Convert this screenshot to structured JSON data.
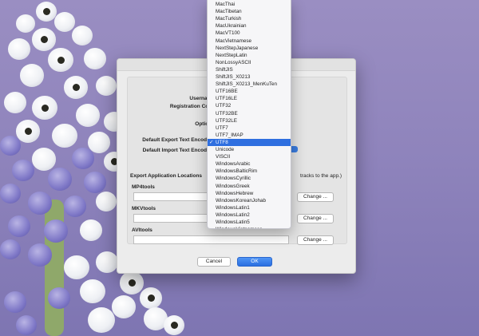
{
  "dialog": {
    "labels": {
      "username": "Username:",
      "registration_code": "Registration Code:",
      "options": "Options:",
      "default_export": "Default Export Text Encoding:",
      "default_import": "Default Import Text Encoding:",
      "export_locations": "Export Application Locations",
      "locations_hint": "tracks to the app.)"
    },
    "tools": [
      {
        "name": "MP4tools",
        "change": "Change ..."
      },
      {
        "name": "MKVtools",
        "change": "Change ..."
      },
      {
        "name": "AVItools",
        "change": "Change ..."
      }
    ],
    "cancel": "Cancel",
    "ok": "OK"
  },
  "encoding_menu": {
    "selected": "UTF8",
    "check_mark": "✓",
    "items": [
      "MacThai",
      "MacTibetan",
      "MacTurkish",
      "MacUkrainian",
      "MacVT100",
      "MacVietnamese",
      "NextStepJapanese",
      "NextStepLatin",
      "NonLossyASCII",
      "ShiftJIS",
      "ShiftJIS_X0213",
      "ShiftJIS_X0213_MenKuTen",
      "UTF16BE",
      "UTF16LE",
      "UTF32",
      "UTF32BE",
      "UTF32LE",
      "UTF7",
      "UTF7_IMAP",
      "UTF8",
      "Unicode",
      "VISCII",
      "WindowsArabic",
      "WindowsBalticRim",
      "WindowsCyrillic",
      "WindowsGreek",
      "WindowsHebrew",
      "WindowsKoreanJohab",
      "WindowsLatin1",
      "WindowsLatin2",
      "WindowsLatin5",
      "WindowsVietnamese"
    ]
  },
  "colors": {
    "accent": "#2f6fe0",
    "desktop": "#8f84bc"
  }
}
